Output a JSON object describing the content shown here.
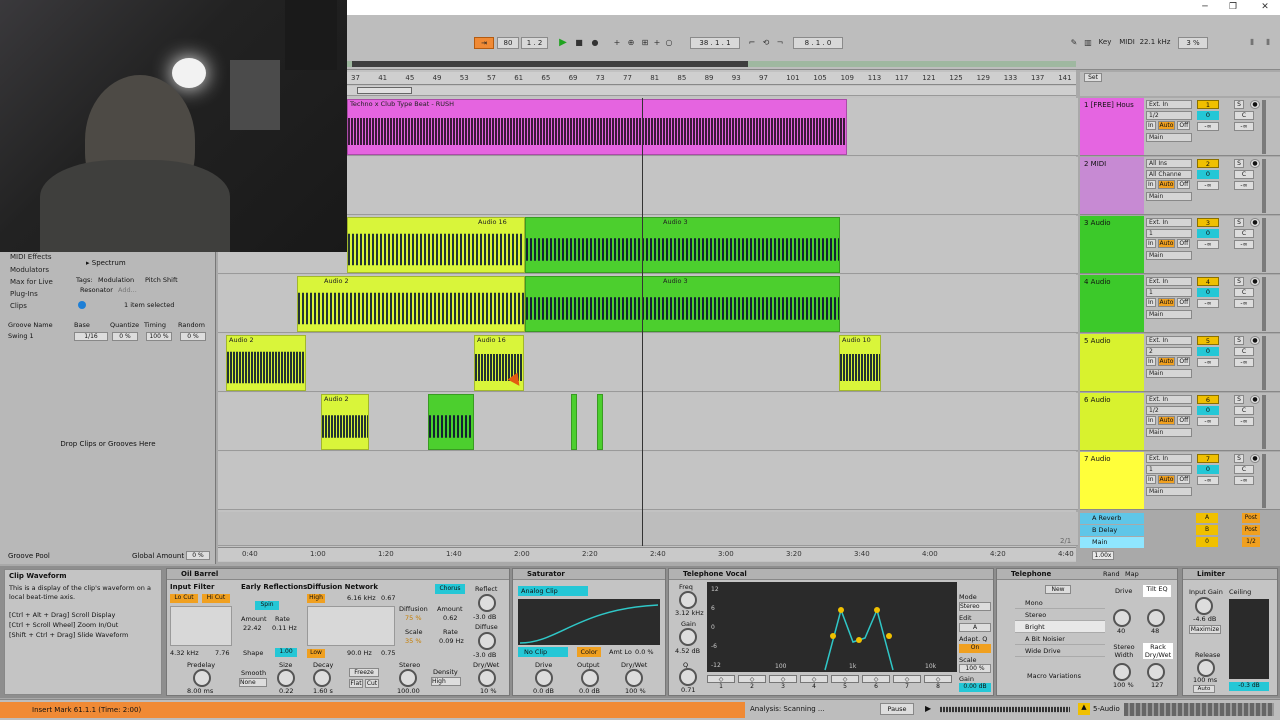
{
  "window": {
    "minimize": "─",
    "restore": "❐",
    "close": "✕"
  },
  "transport": {
    "tempo": "80",
    "signature": "1 . 2",
    "position": "38 . 1 . 1",
    "loop_length": "8 . 1 . 0",
    "key_label": "Key",
    "midi_label": "MIDI",
    "sample_rate": "22.1 kHz",
    "cpu": "3 %"
  },
  "ruler": {
    "bars": [
      "37",
      "41",
      "45",
      "49",
      "53",
      "57",
      "61",
      "65",
      "69",
      "73",
      "77",
      "81",
      "85",
      "89",
      "93",
      "97",
      "101",
      "105",
      "109",
      "113",
      "117",
      "121",
      "125",
      "129",
      "133",
      "137",
      "141"
    ],
    "set_label": "Set"
  },
  "browser": {
    "items": [
      "MIDI Effects",
      "Modulators",
      "Max for Live",
      "Plug-Ins",
      "Clips"
    ],
    "preview_name": "Spectrum",
    "tags_label": "Tags:",
    "tags": [
      "Modulation",
      "Pitch Shift",
      "Resonator",
      "Add..."
    ],
    "selected_text": "1 item selected",
    "groove_headers": [
      "Groove Name",
      "Base",
      "Quantize",
      "Timing",
      "Random"
    ],
    "groove_row": [
      "Swing 1",
      "1/16",
      "0 %",
      "100 %",
      "0 %"
    ],
    "drop_text": "Drop Clips or Grooves Here",
    "groove_pool": "Groove Pool",
    "global_amount_label": "Global Amount",
    "global_amount": "0 %"
  },
  "clips": {
    "techno": "Techno x Club Type Beat - RUSH",
    "audio16": "Audio 16",
    "audio3": "Audio 3",
    "audio2": "Audio 2",
    "audio10": "Audio 10",
    "au": "Au"
  },
  "tracks": [
    {
      "name": "1 [FREE] Hous",
      "input": "Ext. In",
      "channel": "1/2",
      "num": "1",
      "color": "#e565e1"
    },
    {
      "name": "2 MIDI",
      "input": "All Ins",
      "channel": "All Channe",
      "num": "2",
      "color": "#c78ad3"
    },
    {
      "name": "3 Audio",
      "input": "Ext. In",
      "channel": "1",
      "num": "3",
      "color": "#3cc92a"
    },
    {
      "name": "4 Audio",
      "input": "Ext. In",
      "channel": "1",
      "num": "4",
      "color": "#3cc92a"
    },
    {
      "name": "5 Audio",
      "input": "Ext. In",
      "channel": "2",
      "num": "5",
      "color": "#d8f22e"
    },
    {
      "name": "6 Audio",
      "input": "Ext. In",
      "channel": "1/2",
      "num": "6",
      "color": "#d8f22e"
    },
    {
      "name": "7 Audio",
      "input": "Ext. In",
      "channel": "1",
      "num": "7",
      "color": "#ffff3a"
    }
  ],
  "track_common": {
    "in": "In",
    "auto": "Auto",
    "off": "Off",
    "main": "Main",
    "zero": "0",
    "c": "C",
    "inf": "-∞",
    "s": "S"
  },
  "returns": [
    {
      "name": "A Reverb",
      "letter": "A",
      "post": "Post"
    },
    {
      "name": "B Delay",
      "letter": "B",
      "post": "Post"
    },
    {
      "name": "Main",
      "letter": "0",
      "post": "1/2"
    }
  ],
  "timeline": {
    "labels": [
      "0:40",
      "1:00",
      "1:20",
      "1:40",
      "2:00",
      "2:20",
      "2:40",
      "3:00",
      "3:20",
      "3:40",
      "4:00",
      "4:20",
      "4:40"
    ],
    "zoom": "1.00x",
    "page": "2/1"
  },
  "info": {
    "title": "Clip Waveform",
    "text": "This is a display of the clip's waveform on a local beat-time axis.",
    "shortcuts": [
      "[Ctrl + Alt + Drag] Scroll Display",
      "[Ctrl + Scroll Wheel] Zoom In/Out",
      "[Shift + Ctrl + Drag] Slide Waveform"
    ]
  },
  "oil_barrel": {
    "title": "Oil Barrel",
    "input_filter": "Input Filter",
    "lo_cut": "Lo Cut",
    "hi_cut": "Hi Cut",
    "freq1": "4.32 kHz",
    "freq2": "7.76",
    "early": "Early Reflections",
    "spin": "Spin",
    "amount_l": "Amount",
    "amount": "22.42",
    "rate_l": "Rate",
    "rate": "0.11 Hz",
    "shape_l": "Shape",
    "shape": "1.00",
    "diffusion": "Diffusion Network",
    "high": "High",
    "high_freq": "6.16 kHz",
    "high_val": "0.67",
    "low": "Low",
    "low_freq": "90.0 Hz",
    "low_val": "0.75",
    "diff_l": "Diffusion",
    "diff": "75 %",
    "scale_l": "Scale",
    "scale": "35 %",
    "chorus": "Chorus",
    "ch_amount_l": "Amount",
    "ch_amount": "0.62",
    "ch_rate_l": "Rate",
    "ch_rate": "0.09 Hz",
    "predelay_l": "Predelay",
    "predelay": "8.00 ms",
    "smooth_l": "Smooth",
    "smooth": "None",
    "size_l": "Size",
    "size": "0.22",
    "decay_l": "Decay",
    "decay": "1.60 s",
    "freeze": "Freeze",
    "flat": "Flat",
    "cut": "Cut",
    "stereo_l": "Stereo",
    "stereo": "100.00",
    "density_l": "Density",
    "density": "High",
    "reflect_l": "Reflect",
    "reflect": "-3.0 dB",
    "diffuse_l": "Diffuse",
    "diffuse": "-3.0 dB",
    "drywet_l": "Dry/Wet",
    "drywet": "10 %"
  },
  "saturator": {
    "title": "Saturator",
    "mode": "Analog Clip",
    "noclip": "No Clip",
    "color": "Color",
    "amt": "Amt Lo",
    "amt_val": "0.0 %",
    "drive_l": "Drive",
    "drive": "0.0 dB",
    "output_l": "Output",
    "output": "0.0 dB",
    "drywet_l": "Dry/Wet",
    "drywet": "100 %"
  },
  "telephone": {
    "title": "Telephone Vocal",
    "freq_l": "Freq",
    "freq": "3.12 kHz",
    "gain_l": "Gain",
    "gain": "4.52 dB",
    "q_l": "Q",
    "q": "0.71",
    "db_labels": [
      "12",
      "6",
      "0",
      "-6",
      "-12"
    ],
    "hz_labels": [
      "100",
      "1k",
      "10k"
    ],
    "mode_l": "Mode",
    "mode": "Stereo",
    "edit_l": "Edit",
    "edit": "A",
    "adapt_l": "Adapt. Q",
    "adapt": "On",
    "scale_l": "Scale",
    "scale": "100 %",
    "out_gain_l": "Gain",
    "out_gain": "0.00 dB",
    "bands": [
      "1",
      "2",
      "3",
      "4",
      "5",
      "6",
      "7",
      "8"
    ]
  },
  "rack": {
    "title": "Telephone",
    "rand": "Rand",
    "map": "Map",
    "new": "New",
    "presets": [
      "Mono",
      "Stereo",
      "Bright",
      "A Bit Noisier",
      "Wide Drive"
    ],
    "macro": "Macro Variations",
    "drive_l": "Drive",
    "drive": "40",
    "tilt_l": "Tilt EQ",
    "tilt": "48",
    "width_l": "Stereo Width",
    "width": "100 %",
    "rackdw_l": "Rack Dry/Wet",
    "rackdw": "127"
  },
  "limiter": {
    "title": "Limiter",
    "input_l": "Input Gain",
    "input": "-4.6 dB",
    "ceiling_l": "Ceiling",
    "maximize": "Maximize",
    "release_l": "Release",
    "release": "100 ms",
    "auto": "Auto",
    "out": "-0.3 dB"
  },
  "status": {
    "message": "Insert Mark 61.1.1 (Time: 2:00)",
    "analysis": "Analysis: Scanning ...",
    "pause": "Pause",
    "track": "5-Audio"
  }
}
